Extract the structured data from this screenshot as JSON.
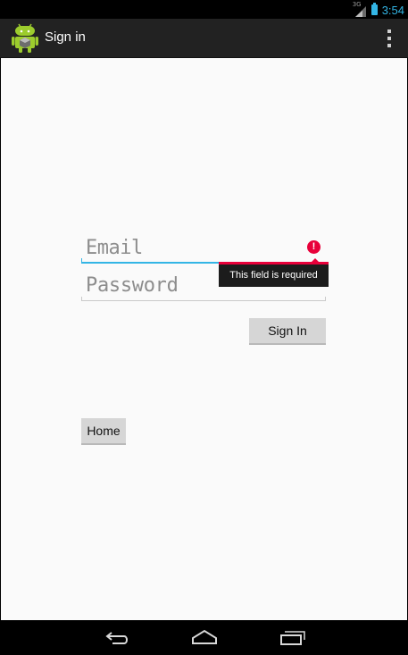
{
  "status_bar": {
    "network": "3G",
    "time": "3:54",
    "accent_color": "#33b5e5"
  },
  "action_bar": {
    "title": "Sign in",
    "app_icon": "android-robot-icon",
    "menu_icon": "overflow-menu-icon"
  },
  "form": {
    "email": {
      "placeholder": "Email",
      "value": ""
    },
    "password": {
      "placeholder": "Password",
      "value": ""
    },
    "error": {
      "icon": "!",
      "message": "This field is required",
      "color": "#e8003a"
    },
    "sign_in_label": "Sign In"
  },
  "home_label": "Home",
  "nav_bar": {
    "back": "back-icon",
    "home": "home-icon",
    "recents": "recents-icon"
  }
}
